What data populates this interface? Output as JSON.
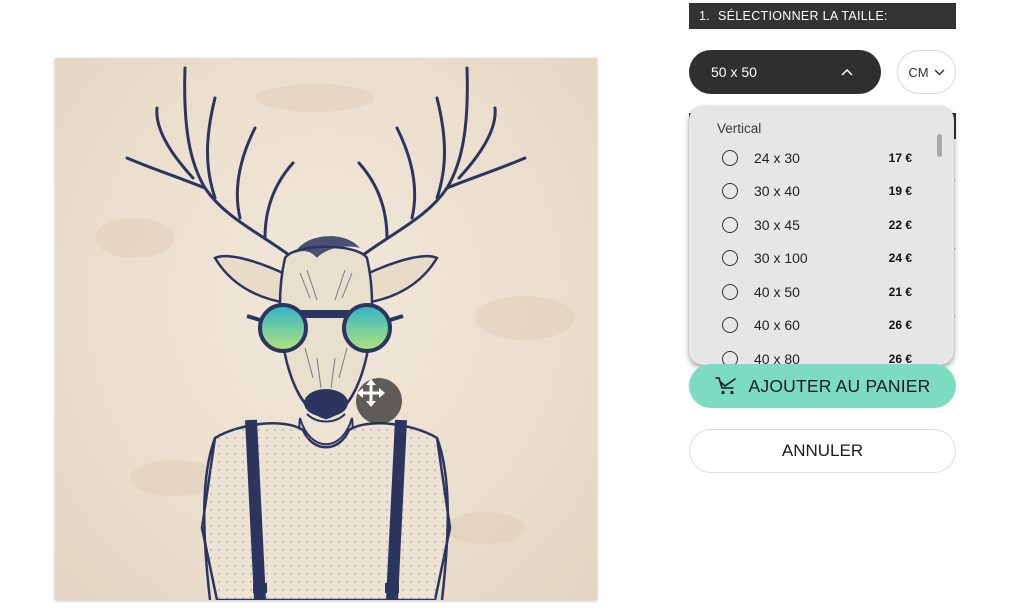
{
  "step": {
    "number": "1.",
    "title": "SÉLECTIONNER LA TAILLE:"
  },
  "size_select": {
    "value": "50 x 50",
    "icon": "chevron-up-icon"
  },
  "unit_select": {
    "value": "CM",
    "icon": "chevron-down-icon"
  },
  "dropdown": {
    "group_label": "Vertical",
    "options": [
      {
        "size": "24 x 30",
        "price": "17 €"
      },
      {
        "size": "30 x 40",
        "price": "19 €"
      },
      {
        "size": "30 x 45",
        "price": "22 €"
      },
      {
        "size": "30 x 100",
        "price": "24 €"
      },
      {
        "size": "40 x 50",
        "price": "21 €"
      },
      {
        "size": "40 x 60",
        "price": "26 €"
      },
      {
        "size": "40 x 80",
        "price": "26 €"
      }
    ]
  },
  "actions": {
    "add_to_cart": "AJOUTER AU PANIER",
    "add_to_cart_icon": "cart-icon",
    "cancel": "ANNULER"
  },
  "preview": {
    "move_icon": "move-arrows-icon"
  },
  "colors": {
    "dark": "#2f2f2f",
    "accent": "#7ddcbf",
    "dropdown_bg": "#e6e6e6",
    "ink": "#2b3560"
  }
}
